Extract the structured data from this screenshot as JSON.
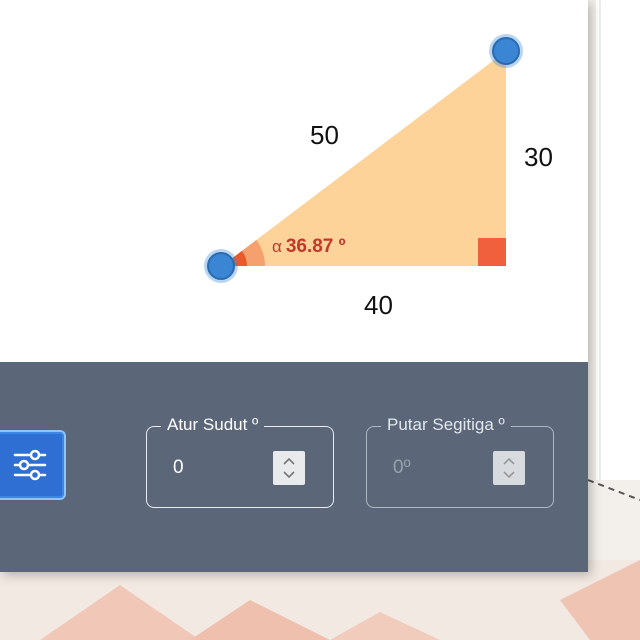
{
  "triangle": {
    "hypotenuse": "50",
    "opposite": "30",
    "adjacent": "40",
    "angle_symbol": "α",
    "angle_value": "36.87 º",
    "fill_color": "#fdd39a",
    "vertex_color": "#3a86d4",
    "right_angle_color": "#f0603c",
    "angle_arc_color": "#e85a2c"
  },
  "controls": {
    "settings_icon": "sliders-icon",
    "set_angle": {
      "label": "Atur Sudut º",
      "value": "0"
    },
    "rotate_triangle": {
      "label": "Putar Segitiga º",
      "value": "0º"
    }
  },
  "colors": {
    "panel": "#5b6778",
    "button": "#2f6fd3"
  }
}
